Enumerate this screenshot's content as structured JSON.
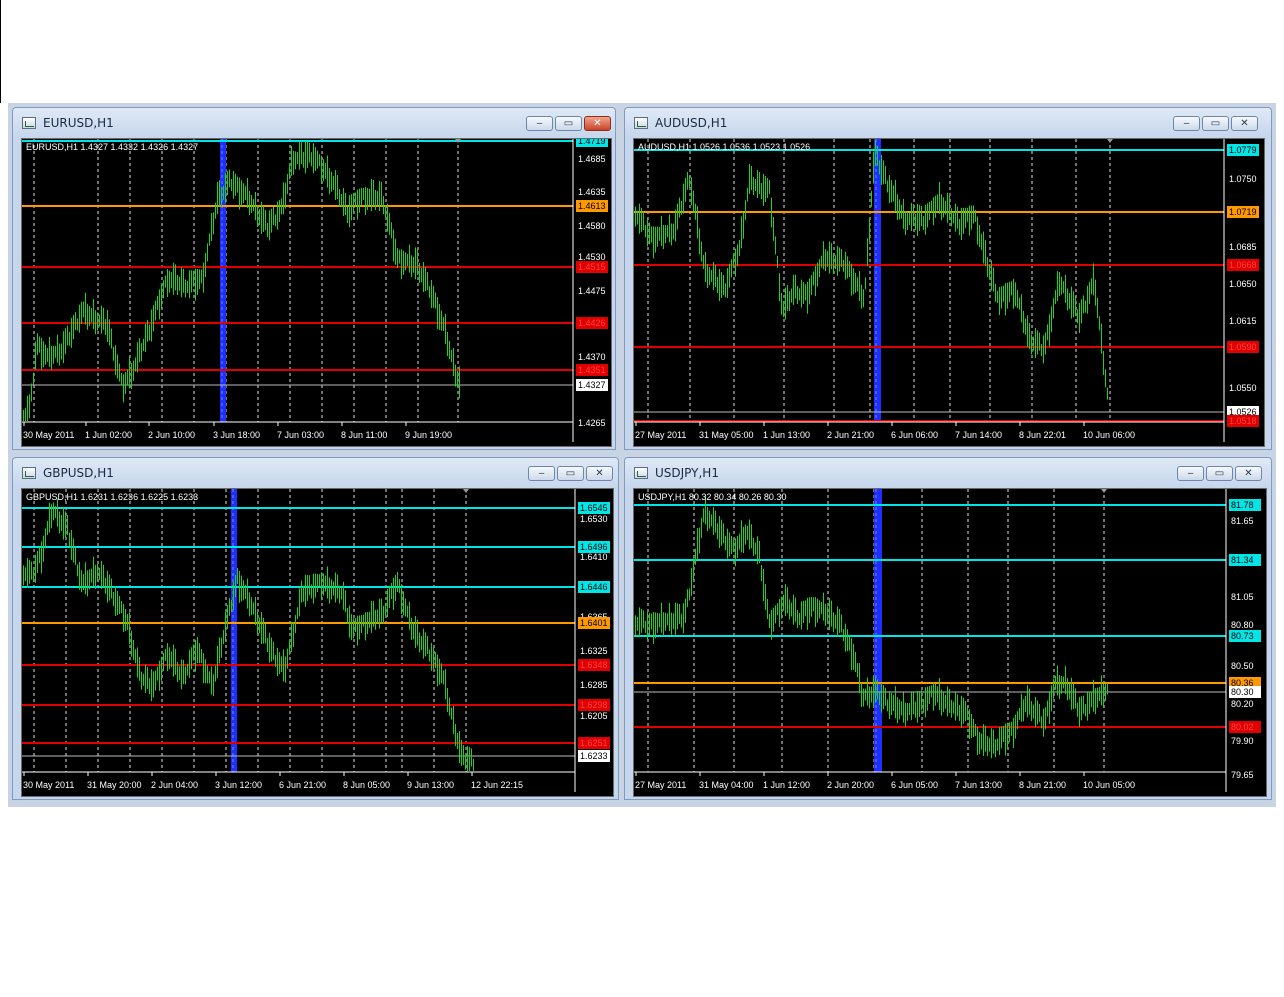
{
  "windows": [
    {
      "id": "eurusd",
      "title": "EURUSD,H1",
      "close_active": true,
      "header_text": "EURUSD,H1  1.4327 1.4332 1.4326 1.4327",
      "y_ticks": [
        "1.4685",
        "1.4635",
        "1.4580",
        "1.4530",
        "1.4475",
        "1.4370",
        "1.4265"
      ],
      "x_labels": [
        "30 May 2011",
        "1 Jun 02:00",
        "2 Jun 10:00",
        "3 Jun 18:00",
        "7 Jun 03:00",
        "8 Jun 11:00",
        "9 Jun 19:00"
      ],
      "levels": [
        {
          "label": "1.4719",
          "color": "#00e5e5",
          "text_color": "#000000"
        },
        {
          "label": "1.4613",
          "color": "#ff9900",
          "text_color": "#000000"
        },
        {
          "label": "1.4515",
          "color": "#e00000",
          "text_color": "#ff4040"
        },
        {
          "label": "1.4426",
          "color": "#e00000",
          "text_color": "#ff4040"
        },
        {
          "label": "1.4351",
          "color": "#e00000",
          "text_color": "#ff4040"
        },
        {
          "label": "1.4327",
          "color": "#bbbbbb",
          "text_color": "#000000",
          "bg": "#ffffff"
        }
      ]
    },
    {
      "id": "audusd",
      "title": "AUDUSD,H1",
      "close_active": false,
      "header_text": "AUDUSD,H1  1.0526 1.0536 1.0523 1.0526",
      "y_ticks": [
        "1.0750",
        "1.0685",
        "1.0650",
        "1.0615",
        "1.0550"
      ],
      "x_labels": [
        "27 May 2011",
        "31 May 05:00",
        "1 Jun 13:00",
        "2 Jun 21:00",
        "6 Jun 06:00",
        "7 Jun 14:00",
        "8 Jun 22:01",
        "10 Jun 06:00"
      ],
      "levels": [
        {
          "label": "1.0779",
          "color": "#00e5e5",
          "text_color": "#000000"
        },
        {
          "label": "1.0719",
          "color": "#ff9900",
          "text_color": "#000000"
        },
        {
          "label": "1.0668",
          "color": "#e00000",
          "text_color": "#ff4040"
        },
        {
          "label": "1.0590",
          "color": "#e00000",
          "text_color": "#ff4040"
        },
        {
          "label": "1.0526",
          "color": "#bbbbbb",
          "text_color": "#000000",
          "bg": "#ffffff"
        },
        {
          "label": "1.0518",
          "color": "#e00000",
          "text_color": "#ff4040"
        }
      ]
    },
    {
      "id": "gbpusd",
      "title": "GBPUSD,H1",
      "close_active": false,
      "header_text": "GBPUSD,H1  1.6231 1.6236 1.6225 1.6233",
      "y_ticks": [
        "1.6530",
        "1.6410",
        "1.6365",
        "1.6325",
        "1.6285",
        "1.6205"
      ],
      "x_labels": [
        "30 May 2011",
        "31 May 20:00",
        "2 Jun 04:00",
        "3 Jun 12:00",
        "6 Jun 21:00",
        "8 Jun 05:00",
        "9 Jun 13:00",
        "12 Jun 22:15"
      ],
      "levels": [
        {
          "label": "1.6545",
          "color": "#00e5e5",
          "text_color": "#000000"
        },
        {
          "label": "1.6496",
          "color": "#00e5e5",
          "text_color": "#000000"
        },
        {
          "label": "1.6446",
          "color": "#00e5e5",
          "text_color": "#000000"
        },
        {
          "label": "1.6401",
          "color": "#ff9900",
          "text_color": "#000000"
        },
        {
          "label": "1.6348",
          "color": "#e00000",
          "text_color": "#ff4040"
        },
        {
          "label": "1.6298",
          "color": "#e00000",
          "text_color": "#ff4040"
        },
        {
          "label": "1.6251",
          "color": "#e00000",
          "text_color": "#ff4040"
        },
        {
          "label": "1.6233",
          "color": "#bbbbbb",
          "text_color": "#000000",
          "bg": "#ffffff"
        }
      ]
    },
    {
      "id": "usdjpy",
      "title": "USDJPY,H1",
      "close_active": false,
      "header_text": "USDJPY,H1  80.32 80.34 80.26 80.30",
      "y_ticks": [
        "81.65",
        "81.05",
        "80.80",
        "80.50",
        "80.20",
        "79.90",
        "79.65"
      ],
      "x_labels": [
        "27 May 2011",
        "31 May 04:00",
        "1 Jun 12:00",
        "2 Jun 20:00",
        "6 Jun 05:00",
        "7 Jun 13:00",
        "8 Jun 21:00",
        "10 Jun 05:00"
      ],
      "levels": [
        {
          "label": "81.78",
          "color": "#00e5e5",
          "text_color": "#000000"
        },
        {
          "label": "81.34",
          "color": "#00e5e5",
          "text_color": "#000000"
        },
        {
          "label": "80.73",
          "color": "#00e5e5",
          "text_color": "#000000"
        },
        {
          "label": "80.36",
          "color": "#ff9900",
          "text_color": "#000000"
        },
        {
          "label": "80.30",
          "color": "#bbbbbb",
          "text_color": "#000000",
          "bg": "#ffffff"
        },
        {
          "label": "80.02",
          "color": "#e00000",
          "text_color": "#ff4040"
        }
      ]
    }
  ]
}
